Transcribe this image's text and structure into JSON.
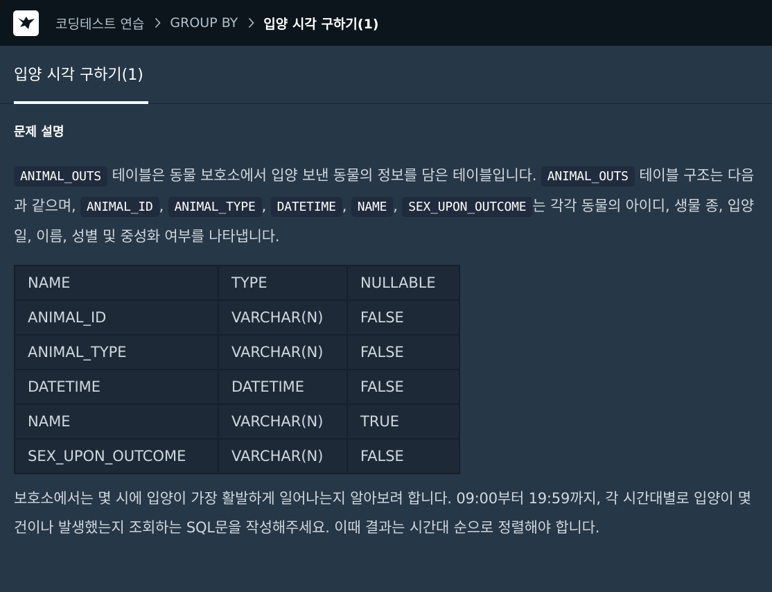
{
  "breadcrumb": {
    "items": [
      "코딩테스트 연습",
      "GROUP BY"
    ],
    "current": "입양 시각 구하기(1)"
  },
  "tab": {
    "label": "입양 시각 구하기(1)"
  },
  "section": {
    "title": "문제 설명"
  },
  "intro": {
    "code1": "ANIMAL_OUTS",
    "t1": "테이블은 동물 보호소에서 입양 보낸 동물의 정보를 담은 테이블입니다.",
    "code2": "ANIMAL_OUTS",
    "t2": "테이블 구조는 다음과 같으며,",
    "code3": "ANIMAL_ID",
    "code4": "ANIMAL_TYPE",
    "code5": "DATETIME",
    "code6": "NAME",
    "code7": "SEX_UPON_OUTCOME",
    "t3": "는 각각 동물의 아이디, 생물 종, 입양일, 이름, 성별 및 중성화 여부를 나타냅니다.",
    "comma": ","
  },
  "table": {
    "headers": [
      "NAME",
      "TYPE",
      "NULLABLE"
    ],
    "rows": [
      [
        "ANIMAL_ID",
        "VARCHAR(N)",
        "FALSE"
      ],
      [
        "ANIMAL_TYPE",
        "VARCHAR(N)",
        "FALSE"
      ],
      [
        "DATETIME",
        "DATETIME",
        "FALSE"
      ],
      [
        "NAME",
        "VARCHAR(N)",
        "TRUE"
      ],
      [
        "SEX_UPON_OUTCOME",
        "VARCHAR(N)",
        "FALSE"
      ]
    ]
  },
  "question": "보호소에서는 몇 시에 입양이 가장 활발하게 일어나는지 알아보려 합니다. 09:00부터 19:59까지, 각 시간대별로 입양이 몇 건이나 발생했는지 조회하는 SQL문을 작성해주세요. 이때 결과는 시간대 순으로 정렬해야 합니다.",
  "icons": {
    "logo": "programmers-bird-logo",
    "separator": "chevron-right-icon"
  }
}
